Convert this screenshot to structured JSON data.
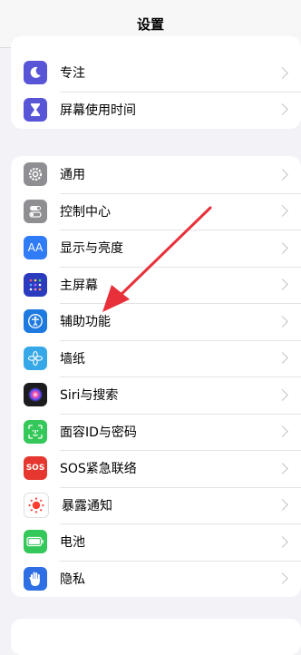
{
  "nav": {
    "title": "设置"
  },
  "group1": {
    "items": [
      {
        "label": "专注",
        "icon": "moon-icon",
        "color": "#5856d6"
      },
      {
        "label": "屏幕使用时间",
        "icon": "hourglass-icon",
        "color": "#5856d6"
      }
    ]
  },
  "group2": {
    "items": [
      {
        "label": "通用",
        "icon": "gear-icon",
        "color": "#8e8e93"
      },
      {
        "label": "控制中心",
        "icon": "toggles-icon",
        "color": "#8e8e93"
      },
      {
        "label": "显示与亮度",
        "icon": "text-size-icon",
        "color": "#2f7cf6",
        "glyph": "AA"
      },
      {
        "label": "主屏幕",
        "icon": "home-grid-icon",
        "color": "#2b3bbf"
      },
      {
        "label": "辅助功能",
        "icon": "accessibility-icon",
        "color": "#1f7ae0"
      },
      {
        "label": "墙纸",
        "icon": "flower-icon",
        "color": "#36a8e8"
      },
      {
        "label": "Siri与搜索",
        "icon": "siri-icon",
        "color": "#1c1c1e"
      },
      {
        "label": "面容ID与密码",
        "icon": "face-id-icon",
        "color": "#34c759"
      },
      {
        "label": "SOS紧急联络",
        "icon": "sos-icon",
        "color": "#e5372f",
        "glyph": "SOS"
      },
      {
        "label": "暴露通知",
        "icon": "exposure-icon",
        "color": "#ffffff"
      },
      {
        "label": "电池",
        "icon": "battery-icon",
        "color": "#34c759"
      },
      {
        "label": "隐私",
        "icon": "hand-icon",
        "color": "#2f6fe4"
      }
    ]
  },
  "annotation": {
    "arrow_color": "#e8303a"
  }
}
